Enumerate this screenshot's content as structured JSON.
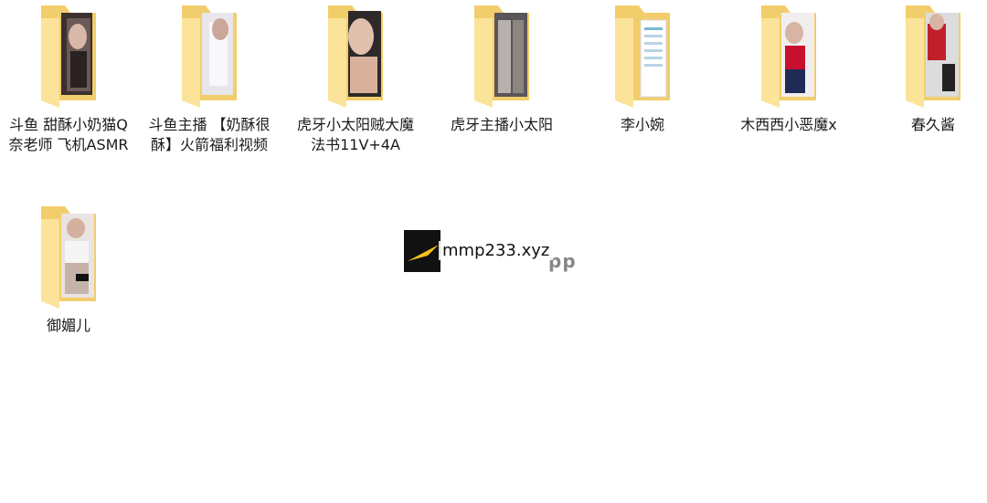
{
  "folders": [
    {
      "name": "斗鱼 甜酥小奶猫Q奈老师 飞机ASMR",
      "preview": "photo-dark"
    },
    {
      "name": "斗鱼主播 【奶酥很酥】火箭福利视频",
      "preview": "photo-white"
    },
    {
      "name": "虎牙小太阳贼大魔法书11V+4A",
      "preview": "photo-skin"
    },
    {
      "name": "虎牙主播小太阳",
      "preview": "photo-gray"
    },
    {
      "name": "李小婉",
      "preview": "document"
    },
    {
      "name": "木西西小恶魔x",
      "preview": "photo-red"
    },
    {
      "name": "春久酱",
      "preview": "photo-red"
    },
    {
      "name": "御媚儿",
      "preview": "photo-skin"
    }
  ],
  "watermark": {
    "text": "mmp233.xyz",
    "sub": "pp"
  },
  "colors": {
    "folder_back": "#f5d67e",
    "folder_front": "#fbe39a",
    "folder_edge": "#e8c060"
  }
}
